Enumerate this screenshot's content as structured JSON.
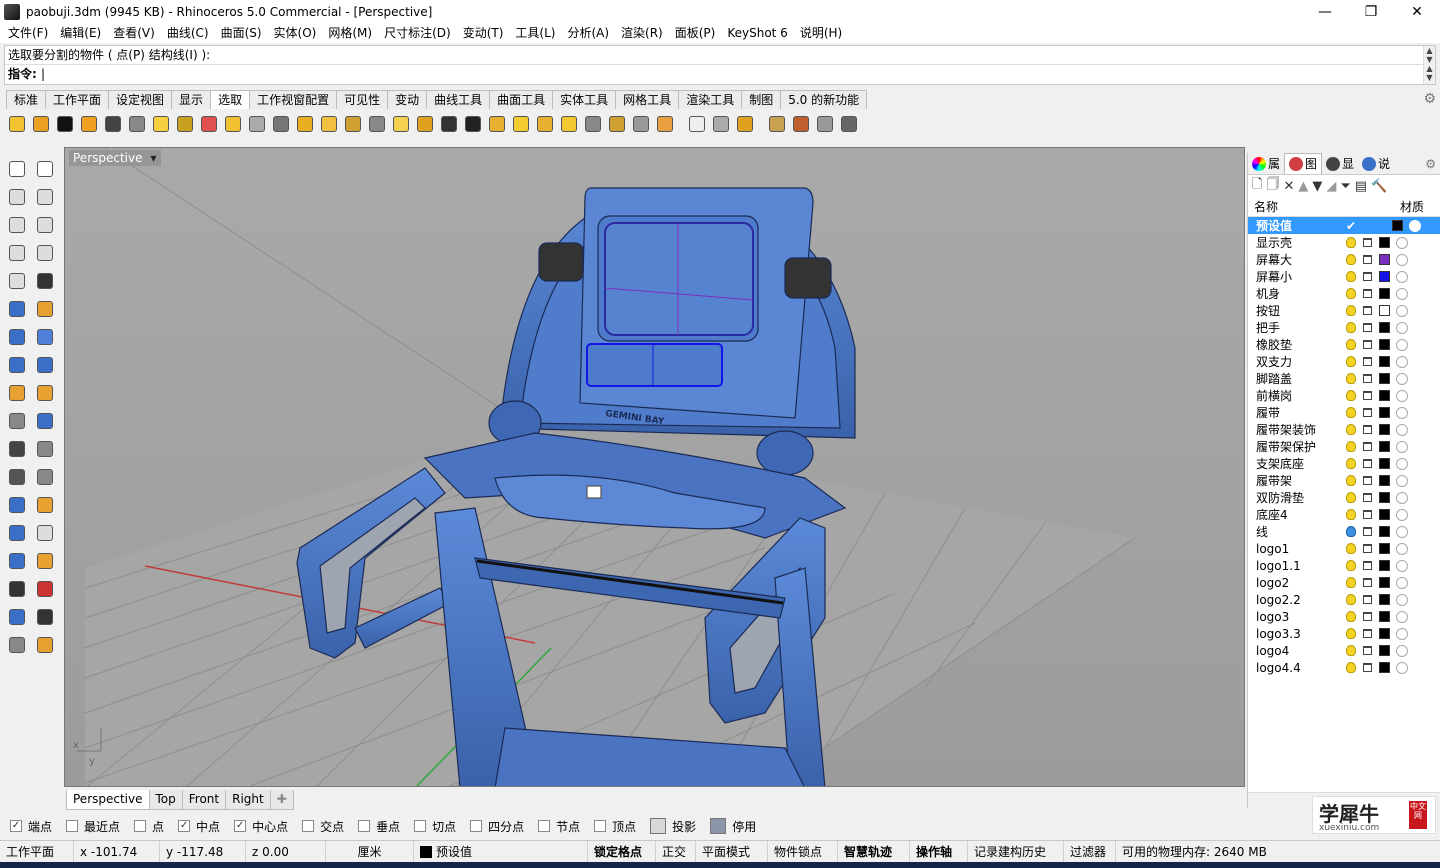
{
  "titlebar": {
    "title": "paobuji.3dm (9945 KB) - Rhinoceros 5.0 Commercial - [Perspective]"
  },
  "menu": [
    "文件(F)",
    "编辑(E)",
    "查看(V)",
    "曲线(C)",
    "曲面(S)",
    "实体(O)",
    "网格(M)",
    "尺寸标注(D)",
    "变动(T)",
    "工具(L)",
    "分析(A)",
    "渲染(R)",
    "面板(P)",
    "KeyShot 6",
    "说明(H)"
  ],
  "command": {
    "history": "选取要分割的物件 ( 点(P)  结构线(I) ):",
    "prompt": "指令:",
    "input_value": ""
  },
  "toolbar_tabs": [
    "标准",
    "工作平面",
    "设定视图",
    "显示",
    "选取",
    "工作视窗配置",
    "可见性",
    "变动",
    "曲线工具",
    "曲面工具",
    "实体工具",
    "网格工具",
    "渲染工具",
    "制图",
    "5.0 的新功能"
  ],
  "active_toolbar_tab": "选取",
  "viewport": {
    "name": "Perspective",
    "model_text": "GEMINI BAY",
    "axis_x": "x",
    "axis_y": "y",
    "colors": {
      "background": "#a3a3a3",
      "model": "#4a78c8",
      "grid": "#8c8c8c",
      "x_axis": "#c23b3b",
      "y_axis": "#2fa83a"
    }
  },
  "view_tabs": [
    "Perspective",
    "Top",
    "Front",
    "Right"
  ],
  "osnap": [
    {
      "label": "端点",
      "checked": true
    },
    {
      "label": "最近点",
      "checked": false
    },
    {
      "label": "点",
      "checked": false
    },
    {
      "label": "中点",
      "checked": true
    },
    {
      "label": "中心点",
      "checked": true
    },
    {
      "label": "交点",
      "checked": false
    },
    {
      "label": "垂点",
      "checked": false
    },
    {
      "label": "切点",
      "checked": false
    },
    {
      "label": "四分点",
      "checked": false
    },
    {
      "label": "节点",
      "checked": false
    },
    {
      "label": "顶点",
      "checked": false
    }
  ],
  "osnap_extra": {
    "project": "投影",
    "disable": "停用"
  },
  "status": {
    "cplane": "工作平面",
    "x": "x -101.74",
    "y": "y -117.48",
    "z": "z 0.00",
    "unit": "厘米",
    "layer": "预设值",
    "grid_snap": "锁定格点",
    "ortho": "正交",
    "planar": "平面模式",
    "osnap": "物件锁点",
    "smarttrack": "智慧轨迹",
    "gumball": "操作轴",
    "history": "记录建构历史",
    "filter": "过滤器",
    "memory": "可用的物理内存: 2640 MB"
  },
  "panel": {
    "tabs": [
      "属",
      "图",
      "显",
      "说"
    ],
    "active_tab": "图",
    "col_name": "名称",
    "col_material": "材质",
    "layers": [
      {
        "name": "预设值",
        "current": true,
        "color": "#000000"
      },
      {
        "name": "显示壳",
        "color": "#000000"
      },
      {
        "name": "屏幕大",
        "color": "#7b2fbe"
      },
      {
        "name": "屏幕小",
        "color": "#1414e6"
      },
      {
        "name": "机身",
        "color": "#000000"
      },
      {
        "name": "按钮",
        "color": "#ffffff"
      },
      {
        "name": "把手",
        "color": "#000000"
      },
      {
        "name": "橡胶垫",
        "color": "#000000"
      },
      {
        "name": "双支力",
        "color": "#000000"
      },
      {
        "name": "脚踏盖",
        "color": "#000000"
      },
      {
        "name": "前横岗",
        "color": "#000000"
      },
      {
        "name": "履带",
        "color": "#000000"
      },
      {
        "name": "履带架装饰",
        "color": "#000000"
      },
      {
        "name": "履带架保护",
        "color": "#000000"
      },
      {
        "name": "支架底座",
        "color": "#000000"
      },
      {
        "name": "履带架",
        "color": "#000000"
      },
      {
        "name": "双防滑垫",
        "color": "#000000"
      },
      {
        "name": "底座4",
        "color": "#000000"
      },
      {
        "name": "线",
        "color": "#000000",
        "bulb": "blue"
      },
      {
        "name": "logo1",
        "color": "#000000"
      },
      {
        "name": "logo1.1",
        "color": "#000000"
      },
      {
        "name": "logo2",
        "color": "#000000"
      },
      {
        "name": "logo2.2",
        "color": "#000000"
      },
      {
        "name": "logo3",
        "color": "#000000"
      },
      {
        "name": "logo3.3",
        "color": "#000000"
      },
      {
        "name": "logo4",
        "color": "#000000"
      },
      {
        "name": "logo4.4",
        "color": "#000000"
      }
    ]
  },
  "watermark": {
    "name": "学犀牛",
    "url": "xuexiniu.com",
    "badge": "中文网"
  }
}
